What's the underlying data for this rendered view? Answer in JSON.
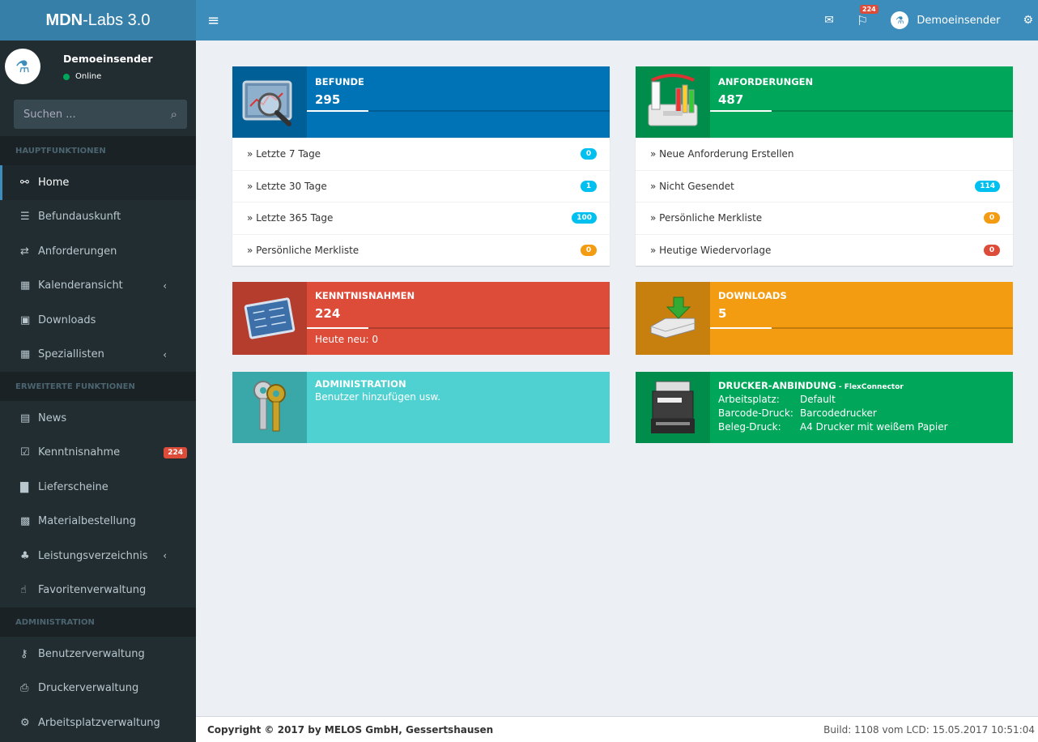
{
  "brand": {
    "bold": "MDN",
    "rest": "-Labs 3.0"
  },
  "navbar": {
    "menu_toggle": "≡",
    "mail_icon": "✉",
    "flag_icon": "⚐",
    "flag_badge": "224",
    "user_name": "Demoeinsender",
    "settings_icon": "⚙"
  },
  "sidebar": {
    "user_name": "Demoeinsender",
    "user_status": "Online",
    "search_placeholder": "Suchen ...",
    "search_icon": "⌕",
    "headers": [
      "HAUPTFUNKTIONEN",
      "ERWEITERTE FUNKTIONEN",
      "ADMINISTRATION"
    ],
    "main_items": [
      {
        "label": "Home",
        "icon": "link-icon",
        "glyph": "⚯"
      },
      {
        "label": "Befundauskunft",
        "icon": "list-icon",
        "glyph": "☰"
      },
      {
        "label": "Anforderungen",
        "icon": "exchange-icon",
        "glyph": "⇄"
      },
      {
        "label": "Kalenderansicht",
        "icon": "calendar-icon",
        "glyph": "▦",
        "chevron": "‹"
      },
      {
        "label": "Downloads",
        "icon": "save-icon",
        "glyph": "▣"
      },
      {
        "label": "Speziallisten",
        "icon": "calendar-icon",
        "glyph": "▦",
        "chevron": "‹"
      }
    ],
    "extended_items": [
      {
        "label": "News",
        "icon": "newspaper-icon",
        "glyph": "▤"
      },
      {
        "label": "Kenntnisnahme",
        "icon": "check-square-icon",
        "glyph": "☑",
        "badge": "224"
      },
      {
        "label": "Lieferscheine",
        "icon": "file-icon",
        "glyph": "▇"
      },
      {
        "label": "Materialbestellung",
        "icon": "medkit-icon",
        "glyph": "▩"
      },
      {
        "label": "Leistungsverzeichnis",
        "icon": "sitemap-icon",
        "glyph": "♣",
        "chevron": "‹"
      },
      {
        "label": "Favoritenverwaltung",
        "icon": "thumbs-up-icon",
        "glyph": "☝"
      }
    ],
    "admin_items": [
      {
        "label": "Benutzerverwaltung",
        "icon": "key-icon",
        "glyph": "⚷"
      },
      {
        "label": "Druckerverwaltung",
        "icon": "print-icon",
        "glyph": "⎙"
      },
      {
        "label": "Arbeitsplatzverwaltung",
        "icon": "cubes-icon",
        "glyph": "⚙"
      }
    ]
  },
  "befunde": {
    "title": "BEFUNDE",
    "count": "295",
    "rows": [
      {
        "label": "» Letzte 7 Tage",
        "badge": "0"
      },
      {
        "label": "» Letzte 30 Tage",
        "badge": "1"
      },
      {
        "label": "» Letzte 365 Tage",
        "badge": "100"
      },
      {
        "label": "» Persönliche Merkliste",
        "badge": "0"
      }
    ]
  },
  "anforderungen": {
    "title": "ANFORDERUNGEN",
    "count": "487",
    "rows": [
      {
        "label": "» Neue Anforderung Erstellen",
        "badge": ""
      },
      {
        "label": "» Nicht Gesendet",
        "badge": "114"
      },
      {
        "label": "» Persönliche Merkliste",
        "badge": "0"
      },
      {
        "label": "» Heutige Wiedervorlage",
        "badge": "0"
      }
    ]
  },
  "kenntnisnahmen": {
    "title": "KENNTNISNAHMEN",
    "count": "224",
    "sub": "Heute neu: 0"
  },
  "downloads": {
    "title": "DOWNLOADS",
    "count": "5"
  },
  "administration": {
    "title": "ADMINISTRATION",
    "sub": "Benutzer hinzufügen usw."
  },
  "drucker": {
    "title": "DRUCKER-ANBINDUNG",
    "title_suffix": " - FlexConnector",
    "rows": [
      {
        "key": "Arbeitsplatz:",
        "value": "Default"
      },
      {
        "key": "Barcode-Druck:",
        "value": "Barcodedrucker"
      },
      {
        "key": "Beleg-Druck:",
        "value": "A4 Drucker mit weißem Papier"
      }
    ]
  },
  "footer": {
    "copyright": "Copyright © 2017 by MELOS GmbH, Gessertshausen",
    "build": "Build: 1108 vom LCD: 15.05.2017 10:51:04"
  },
  "colors": {
    "befunde": "#0073b7",
    "anforderungen": "#00a65a",
    "kenntnisnahmen": "#dd4b39",
    "downloads": "#f39c12",
    "administration": "#39cccc",
    "badge_aqua": "#00c0ef",
    "badge_orange": "#f39c12",
    "badge_red": "#dd4b39"
  }
}
